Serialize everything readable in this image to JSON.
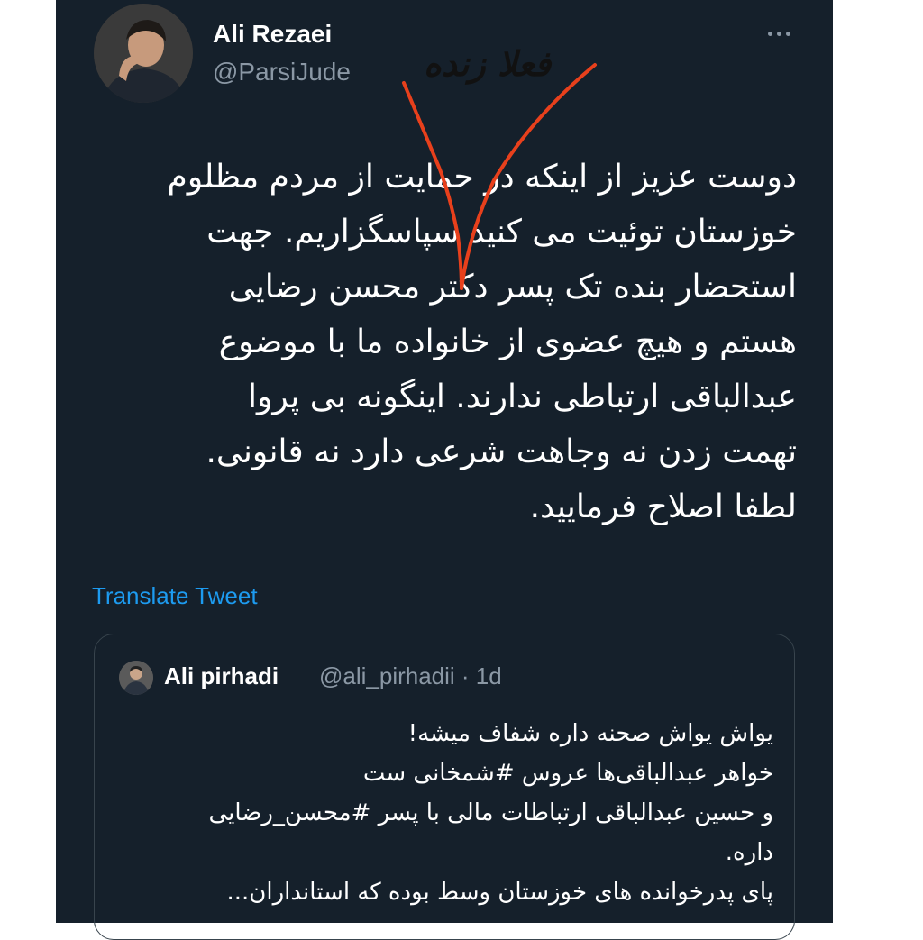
{
  "tweet": {
    "author_name": "Ali Rezaei",
    "author_handle": "@ParsiJude",
    "more_icon": "more-dots-icon",
    "text": "دوست عزیز از اینکه در حمایت از مردم مظلوم\nخوزستان توئیت می کنید سپاسگزاریم. جهت\nاستحضار بنده تک پسر دکتر محسن رضایی\nهستم و هیچ عضوی از خانواده ما با موضوع\nعبدالباقی ارتباطی ندارند. اینگونه بی پروا\nتهمت زدن نه وجاهت شرعی دارد نه قانونی.\nلطفا اصلاح فرمایید.",
    "translate_label": "Translate Tweet"
  },
  "annotation": {
    "text": "فعلا زنده",
    "color": "#e8401c"
  },
  "quoted": {
    "author_name": "Ali pirhadi",
    "meta": "@ali_pirhadii · 1d",
    "lines": [
      "یواش یواش صحنه داره شفاف میشه!",
      "خواهر عبدالباقی‌ها عروس #شمخانی ست",
      "و حسین عبدالباقی ارتباطات مالی با پسر #محسن_رضایی",
      "داره.",
      "پای پدرخوانده های خوزستان وسط بوده که استانداران..."
    ]
  },
  "colors": {
    "background": "#15202b",
    "text": "#ffffff",
    "secondary": "#8b98a5",
    "link": "#1d9bf0",
    "border": "#38444d"
  }
}
